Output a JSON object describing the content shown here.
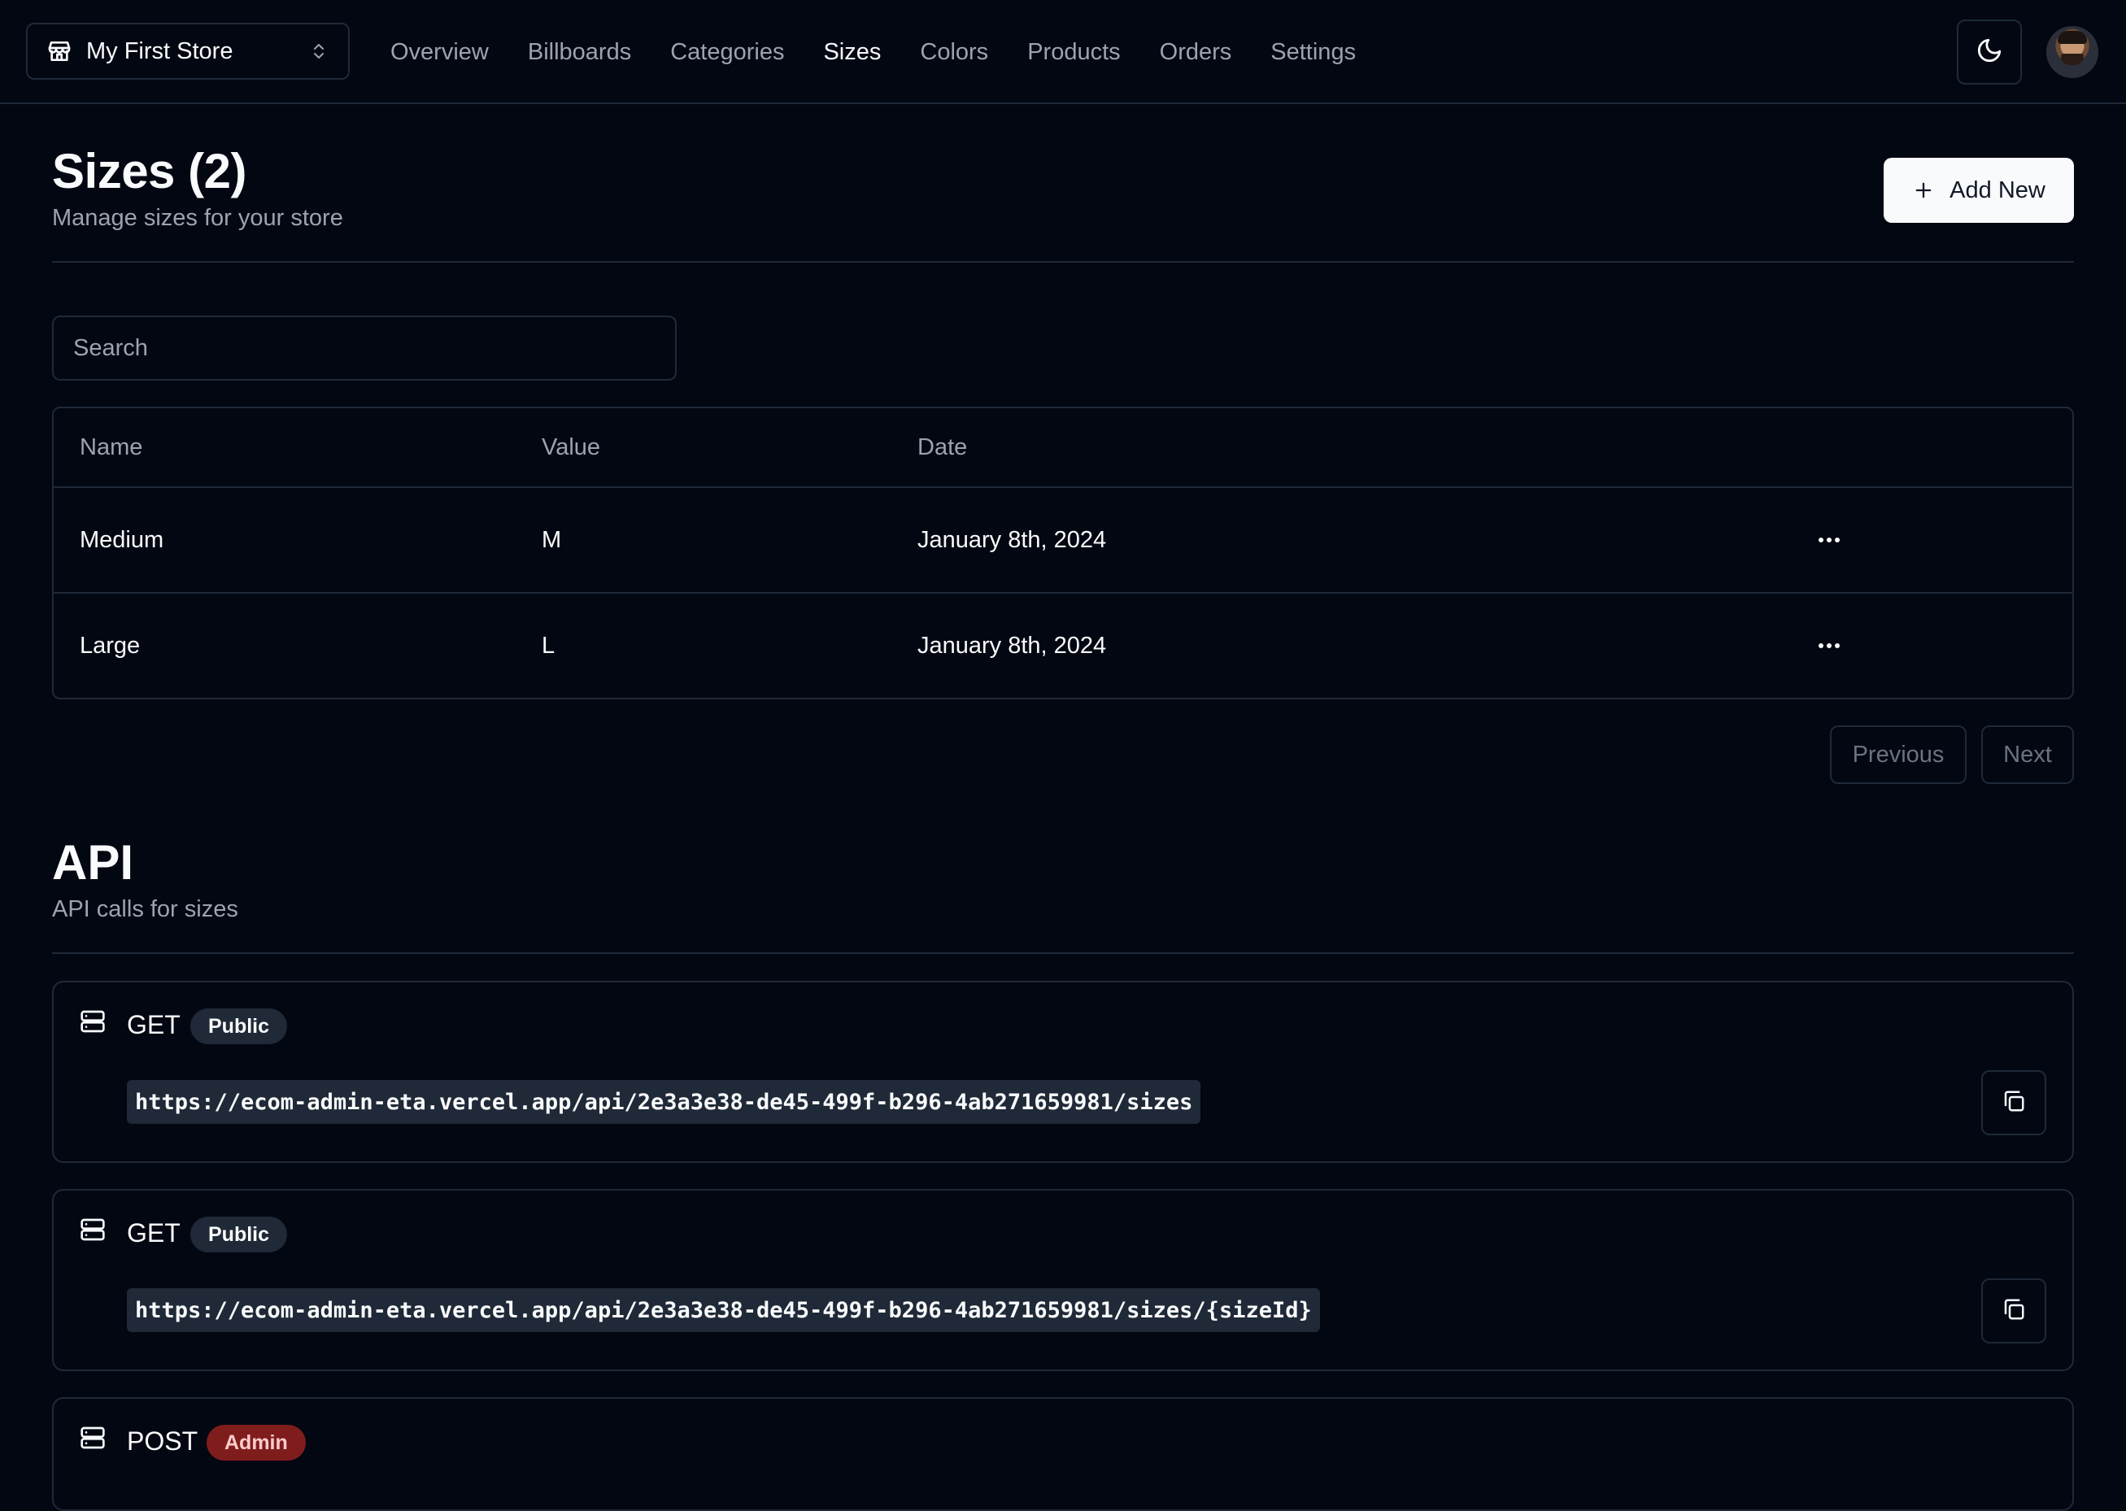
{
  "header": {
    "store_name": "My First Store",
    "nav": [
      {
        "label": "Overview"
      },
      {
        "label": "Billboards"
      },
      {
        "label": "Categories"
      },
      {
        "label": "Sizes",
        "active": true
      },
      {
        "label": "Colors"
      },
      {
        "label": "Products"
      },
      {
        "label": "Orders"
      },
      {
        "label": "Settings"
      }
    ]
  },
  "page": {
    "title": "Sizes (2)",
    "subtitle": "Manage sizes for your store",
    "add_new_label": "Add New"
  },
  "search": {
    "placeholder": "Search",
    "value": ""
  },
  "table": {
    "columns": [
      "Name",
      "Value",
      "Date"
    ],
    "rows": [
      {
        "name": "Medium",
        "value": "M",
        "date": "January 8th, 2024"
      },
      {
        "name": "Large",
        "value": "L",
        "date": "January 8th, 2024"
      }
    ]
  },
  "pagination": {
    "previous_label": "Previous",
    "next_label": "Next"
  },
  "api": {
    "title": "API",
    "subtitle": "API calls for sizes",
    "endpoints": [
      {
        "method": "GET",
        "access": "Public",
        "url": "https://ecom-admin-eta.vercel.app/api/2e3a3e38-de45-499f-b296-4ab271659981/sizes"
      },
      {
        "method": "GET",
        "access": "Public",
        "url": "https://ecom-admin-eta.vercel.app/api/2e3a3e38-de45-499f-b296-4ab271659981/sizes/{sizeId}"
      },
      {
        "method": "POST",
        "access": "Admin",
        "url": ""
      }
    ]
  },
  "colors": {
    "background": "#030712",
    "border": "#1f2937",
    "muted_text": "#9ca3af",
    "admin_badge": "#7f1d1d",
    "primary_button": "#f9fafb"
  },
  "icons": {
    "store": "store-icon",
    "switcher": "chevrons-up-down-icon",
    "theme": "moon-icon",
    "add": "plus-icon",
    "row_menu": "more-horizontal-icon",
    "endpoint": "server-icon",
    "copy": "copy-icon"
  }
}
